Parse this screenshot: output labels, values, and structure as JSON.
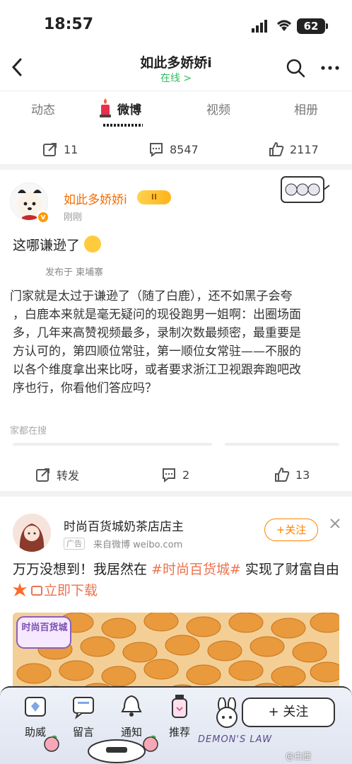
{
  "status": {
    "time": "18:57",
    "battery": "62"
  },
  "header": {
    "title": "如此多娇娇i",
    "subtitle": "在线 >"
  },
  "tabs": [
    {
      "label": "动态"
    },
    {
      "label": "微博"
    },
    {
      "label": "视频"
    },
    {
      "label": "相册"
    }
  ],
  "first_card_actions": {
    "reposts": "11",
    "comments": "8547",
    "likes": "2117"
  },
  "post": {
    "username": "如此多娇娇i",
    "level_badge": "II",
    "time": "刚刚",
    "text": "这哪谦逊了",
    "location": "发布于 柬埔寨",
    "quote_lines": [
      "门家就是太过于谦逊了（随了白鹿），还不如黑子会夸",
      "，白鹿本来就是毫无疑问的现役跑男一姐啊：出圈场面",
      "多，几年来高赞视频最多，录制次数最频密，最重要是",
      "方认可的，第四顺位常驻，第一顺位女常驻——不服的",
      "以各个维度拿出来比呀，或者要求浙江卫视跟奔跑吧改",
      "序也行，你看他们答应吗？"
    ],
    "search_hint": "家都在搜",
    "actions": {
      "repost": "转发",
      "comments": "2",
      "likes": "13"
    }
  },
  "ad": {
    "name": "时尚百货城奶茶店店主",
    "tag": "广告",
    "source": "来自微博 weibo.com",
    "follow": "+关注",
    "text_before": "万万没想到！我居然在 ",
    "topic": "#时尚百货城#",
    "text_after": " 实现了财富自由",
    "download": "立即下载",
    "image_logo": "时尚百货城"
  },
  "bottom_bar": {
    "items": [
      {
        "label": "助威"
      },
      {
        "label": "留言"
      },
      {
        "label": "通知"
      },
      {
        "label": "推荐"
      }
    ],
    "follow": "+ 关注",
    "brand_text": "DEMON'S LAW",
    "watermark": "@白鹿"
  },
  "colors": {
    "accent": "#ff8200",
    "username": "#f56c00",
    "online": "#2fbf5c",
    "topic": "#eb7350"
  }
}
